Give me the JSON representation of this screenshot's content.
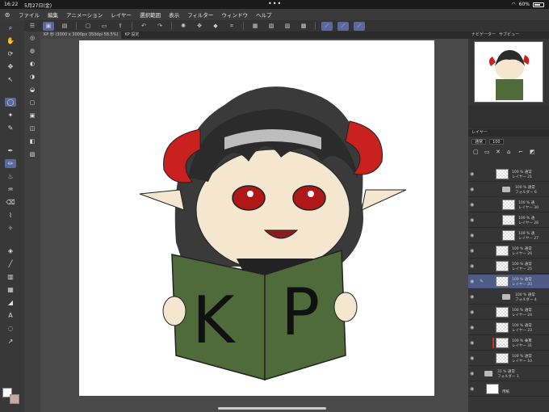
{
  "status": {
    "time": "16:22",
    "date": "5月27日(金)",
    "dots": "•••",
    "battery": "60%"
  },
  "menubar": {
    "items": [
      "ファイル",
      "編集",
      "アニメーション",
      "レイヤー",
      "選択範囲",
      "表示",
      "フィルター",
      "ウィンドウ",
      "ヘルプ"
    ]
  },
  "tabs": [
    {
      "label": "KP 秒 (3000 x 3000px 350dpi 58.5%)"
    },
    {
      "label": "KP 設定"
    }
  ],
  "panel": {
    "navigator_title": "ナビゲーター",
    "navigator_tab2": "サブビュー",
    "layer_tab": "レイヤー",
    "blend_mode": "通常",
    "opacity": "100"
  },
  "canvas": {
    "book_left_letter": "K",
    "book_right_letter": "P"
  },
  "layers": [
    {
      "line1": "100 % 通常",
      "line2": "レイヤー 21",
      "type": "layer"
    },
    {
      "line1": "100 % 通常",
      "line2": "フォルダー 6",
      "type": "folder"
    },
    {
      "line1": "100 % 通",
      "line2": "レイヤー 30",
      "type": "layer"
    },
    {
      "line1": "100 % 通",
      "line2": "レイヤー 28",
      "type": "layer"
    },
    {
      "line1": "100 % 通",
      "line2": "レイヤー 27",
      "type": "layer"
    },
    {
      "line1": "100 % 通常",
      "line2": "レイヤー 26",
      "type": "layer"
    },
    {
      "line1": "100 % 通常",
      "line2": "レイヤー 25",
      "type": "layer"
    },
    {
      "line1": "100 % 通常",
      "line2": "レイヤー 20",
      "type": "layer"
    },
    {
      "line1": "100 % 通常",
      "line2": "フォルダー 4",
      "type": "folder"
    },
    {
      "line1": "100 % 通常",
      "line2": "レイヤー 24",
      "type": "layer"
    },
    {
      "line1": "100 % 通常",
      "line2": "レイヤー 23",
      "type": "layer"
    },
    {
      "line1": "100 % 乗算",
      "line2": "レイヤー 31",
      "type": "layer"
    },
    {
      "line1": "100 % 通常",
      "line2": "レイヤー 10",
      "type": "layer"
    },
    {
      "line1": "31 % 通常",
      "line2": "フォルダー 1",
      "type": "folder"
    },
    {
      "line1": "",
      "line2": "用紙",
      "type": "paper"
    }
  ],
  "colors": {
    "canvas_bg": "#4a4a4a",
    "accent": "#5a6aa0",
    "book": "#4f6b3a",
    "horn": "#c8211e"
  }
}
